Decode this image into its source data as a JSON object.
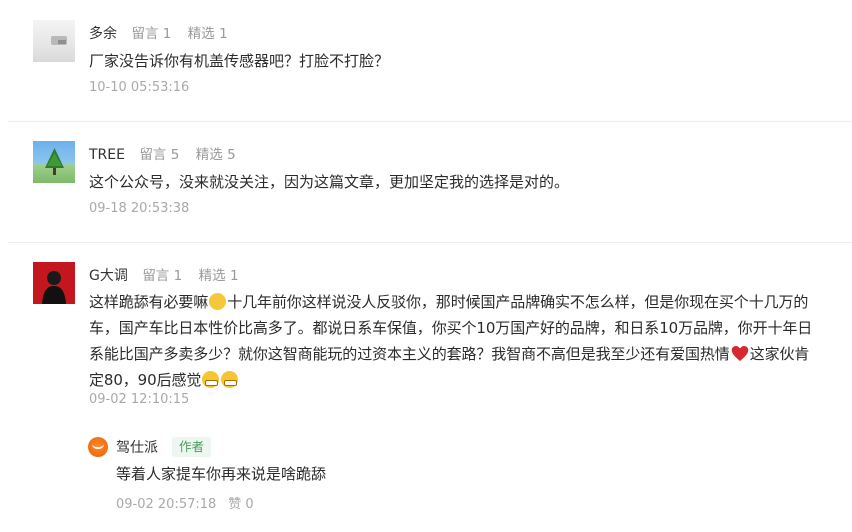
{
  "comments": [
    {
      "name": "多余",
      "replies_count": "留言 1",
      "featured_count": "精选 1",
      "text": "厂家没告诉你有机盖传感器吧？打脸不打脸？",
      "time": "10-10 05:53:16",
      "avatar_icon": "blurred-gray-avatar"
    },
    {
      "name": "TREE",
      "replies_count": "留言 5",
      "featured_count": "精选 5",
      "text": "这个公众号，没来就没关注，因为这篇文章，更加坚定我的选择是对的。",
      "time": "09-18 20:53:38",
      "avatar_icon": "tree-landscape-avatar"
    },
    {
      "name": "G大调",
      "replies_count": "留言 1",
      "featured_count": "精选 1",
      "text_lines": [
        "这样跪舔有必要嘛",
        "十几年前你这样说没人反驳你，那时候国产品牌确实不怎么样，但是你现在买个十几万的",
        "车，国产车比日本性价比高多了。都说日系车保值，你买个10万国产好的品牌，和日系10万品牌，你开十年日",
        "系能比国产多卖多少？就你这智商能玩的过资本主义的套路？我智商不高但是我至少还有爱国热情",
        "这家伙肯",
        "定80，90后感觉"
      ],
      "time": "09-02 12:10:15",
      "avatar_icon": "person-red-background-avatar",
      "reply": {
        "name": "驾仕派",
        "tag": "作者",
        "text": "等着人家提车你再来说是啥跪舔",
        "time": "09-02 20:57:18",
        "likes": "赞 0",
        "avatar_icon": "orange-smile-logo-avatar"
      }
    }
  ],
  "emojis": [
    "awkward-emoji",
    "heart-emoji",
    "grin-emoji"
  ],
  "colors": {
    "meta": "#a9a9a9",
    "author_tag_text": "#4a9d5e",
    "author_tag_bg": "#eef6f0",
    "divider": "#ececec"
  }
}
